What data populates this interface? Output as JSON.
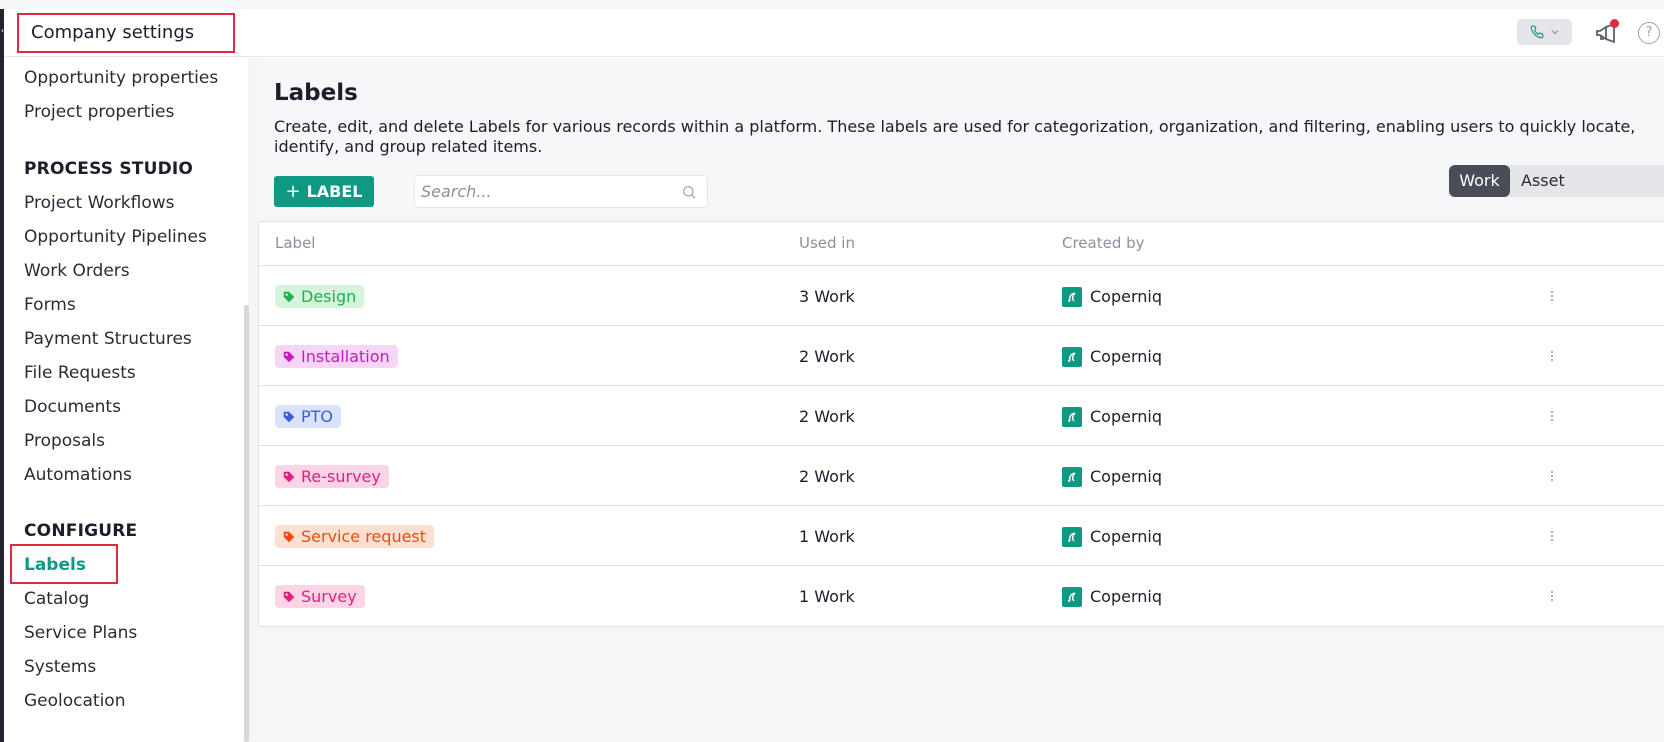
{
  "header": {
    "title": "Company settings",
    "icons": [
      "phone-icon",
      "megaphone-icon",
      "help-icon"
    ]
  },
  "sidebar": {
    "items_top": [
      {
        "label": "Opportunity properties"
      },
      {
        "label": "Project properties"
      }
    ],
    "process_studio": {
      "heading": "PROCESS STUDIO",
      "items": [
        {
          "label": "Project Workflows"
        },
        {
          "label": "Opportunity Pipelines"
        },
        {
          "label": "Work Orders"
        },
        {
          "label": "Forms"
        },
        {
          "label": "Payment Structures"
        },
        {
          "label": "File Requests"
        },
        {
          "label": "Documents"
        },
        {
          "label": "Proposals"
        },
        {
          "label": "Automations"
        }
      ]
    },
    "configure": {
      "heading": "CONFIGURE",
      "items": [
        {
          "label": "Labels",
          "active": true
        },
        {
          "label": "Catalog"
        },
        {
          "label": "Service Plans"
        },
        {
          "label": "Systems"
        },
        {
          "label": "Geolocation"
        }
      ]
    }
  },
  "main": {
    "title": "Labels",
    "description": "Create, edit, and delete Labels for various records within a platform. These labels are used for categorization, organization, and filtering, enabling users to quickly locate, identify, and group related items.",
    "add_button": {
      "plus": "+",
      "label": "LABEL"
    },
    "search": {
      "placeholder": "Search...",
      "value": ""
    },
    "toggle": {
      "work": "Work",
      "asset": "Asset",
      "selected": "Work"
    },
    "table": {
      "columns": [
        "Label",
        "Used in",
        "Created by"
      ],
      "rows": [
        {
          "label": "Design",
          "used_in": "3 Work",
          "created_by": "Coperniq",
          "text_color": "#1fb050",
          "bg_color": "#d4f5dc"
        },
        {
          "label": "Installation",
          "used_in": "2 Work",
          "created_by": "Coperniq",
          "text_color": "#c21cc2",
          "bg_color": "#f7d5f5"
        },
        {
          "label": "PTO",
          "used_in": "2 Work",
          "created_by": "Coperniq",
          "text_color": "#3a5fd9",
          "bg_color": "#dae3fb"
        },
        {
          "label": "Re-survey",
          "used_in": "2 Work",
          "created_by": "Coperniq",
          "text_color": "#e0207e",
          "bg_color": "#fbd4e6"
        },
        {
          "label": "Service request",
          "used_in": "1 Work",
          "created_by": "Coperniq",
          "text_color": "#f04a12",
          "bg_color": "#fde0d2"
        },
        {
          "label": "Survey",
          "used_in": "1 Work",
          "created_by": "Coperniq",
          "text_color": "#e0207e",
          "bg_color": "#fbd4e6"
        }
      ]
    }
  },
  "colors": {
    "accent": "#0e9a82",
    "highlight_border": "#e0283e"
  }
}
